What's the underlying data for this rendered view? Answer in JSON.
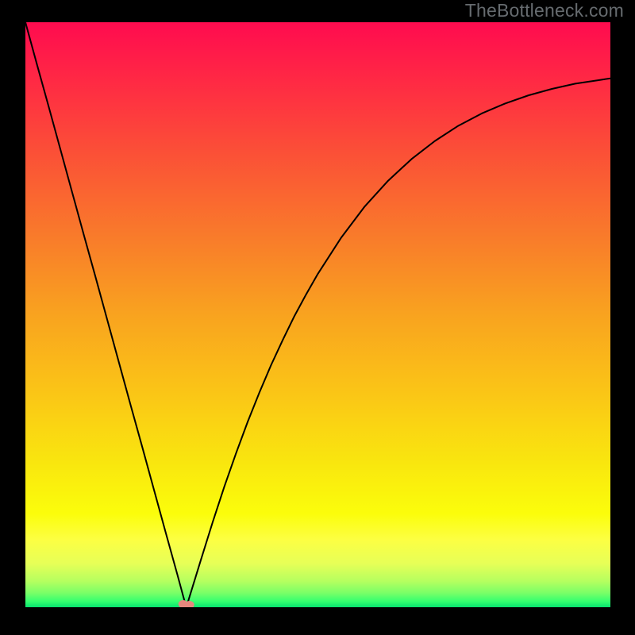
{
  "watermark": "TheBottleneck.com",
  "chart_data": {
    "type": "line",
    "title": "",
    "xlabel": "",
    "ylabel": "",
    "xlim": [
      0,
      1
    ],
    "ylim": [
      0,
      1
    ],
    "x": [
      0.0,
      0.02,
      0.04,
      0.06,
      0.08,
      0.1,
      0.12,
      0.14,
      0.16,
      0.18,
      0.2,
      0.22,
      0.24,
      0.26,
      0.27,
      0.275,
      0.28,
      0.3,
      0.32,
      0.34,
      0.36,
      0.38,
      0.4,
      0.42,
      0.44,
      0.46,
      0.48,
      0.5,
      0.54,
      0.58,
      0.62,
      0.66,
      0.7,
      0.74,
      0.78,
      0.82,
      0.86,
      0.9,
      0.94,
      0.98,
      1.0
    ],
    "y": [
      1.0,
      0.927,
      0.855,
      0.782,
      0.709,
      0.636,
      0.564,
      0.491,
      0.418,
      0.345,
      0.273,
      0.2,
      0.127,
      0.055,
      0.018,
      0.0,
      0.016,
      0.081,
      0.145,
      0.206,
      0.263,
      0.317,
      0.367,
      0.414,
      0.457,
      0.498,
      0.535,
      0.57,
      0.632,
      0.685,
      0.729,
      0.766,
      0.797,
      0.823,
      0.844,
      0.861,
      0.875,
      0.886,
      0.895,
      0.901,
      0.904
    ],
    "marker": {
      "x": 0.275,
      "y": 0.0
    },
    "background": {
      "type": "vertical-gradient",
      "stops": [
        {
          "pos": 0.0,
          "color": "#ff0b4f"
        },
        {
          "pos": 0.1,
          "color": "#ff2944"
        },
        {
          "pos": 0.22,
          "color": "#fb4f37"
        },
        {
          "pos": 0.36,
          "color": "#f9792b"
        },
        {
          "pos": 0.5,
          "color": "#f9a31f"
        },
        {
          "pos": 0.64,
          "color": "#fac716"
        },
        {
          "pos": 0.76,
          "color": "#f9e80e"
        },
        {
          "pos": 0.84,
          "color": "#fbfd0b"
        },
        {
          "pos": 0.885,
          "color": "#fcff43"
        },
        {
          "pos": 0.925,
          "color": "#e7ff57"
        },
        {
          "pos": 0.955,
          "color": "#b6ff5f"
        },
        {
          "pos": 0.975,
          "color": "#7cff67"
        },
        {
          "pos": 0.99,
          "color": "#35ff6f"
        },
        {
          "pos": 1.0,
          "color": "#06e36f"
        }
      ]
    }
  }
}
